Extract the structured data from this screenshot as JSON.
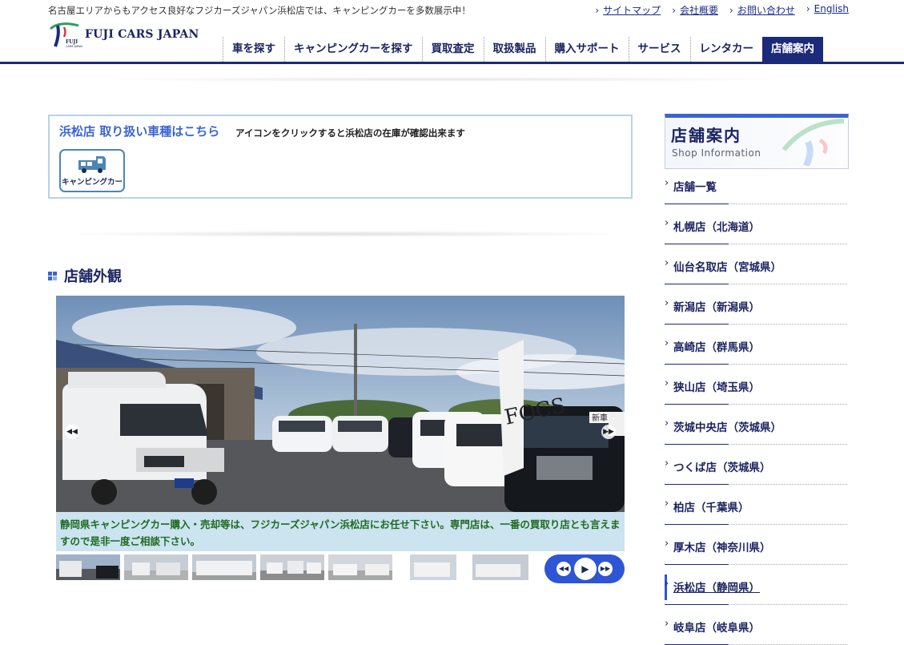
{
  "header": {
    "tagline": "名古屋エリアからもアクセス良好なフジカーズジャパン浜松店では、キャンピングカーを多数展示中！",
    "toplinks": [
      "サイトマップ",
      "会社概要",
      "お問い合わせ",
      "English"
    ],
    "logo_text": "FUJI CARS JAPAN",
    "logo_small": "FUJI",
    "logo_sub": "CARS JAPAN",
    "nav": [
      "車を探す",
      "キャンピングカーを探す",
      "買取査定",
      "取扱製品",
      "購入サポート",
      "サービス",
      "レンタカー",
      "店舗案内"
    ],
    "active_nav": "店舗案内"
  },
  "infobox": {
    "heading": "浜松店 取り扱い車種はこちら",
    "note": "アイコンをクリックすると浜松店の在庫が確認出来ます",
    "icon_label": "キャンピングカー",
    "icon": "camper-icon"
  },
  "section": {
    "title": "店舗外観"
  },
  "slideshow": {
    "caption": "静岡県キャンピングカー購入・売却等は、フジカーズジャパン浜松店にお任せ下さい。専門店は、一番の買取り店とも言えますので是非一度ご相談下さい。",
    "sign_text": "FOCS",
    "banner_text": "新車",
    "prev_icon": "chevrons-left-icon",
    "next_icon": "chevrons-right-icon",
    "play_icon": "play-icon"
  },
  "sidebar": {
    "title_jp": "店舗案内",
    "title_en": "Shop Information",
    "items": [
      "店舗一覧",
      "札幌店（北海道）",
      "仙台名取店（宮城県）",
      "新潟店（新潟県）",
      "高崎店（群馬県）",
      "狭山店（埼玉県）",
      "茨城中央店（茨城県）",
      "つくば店（茨城県）",
      "柏店（千葉県）",
      "厚木店（神奈川県）",
      "浜松店（静岡県）",
      "岐阜店（岐阜県）"
    ],
    "active_item": "浜松店（静岡県）"
  },
  "colors": {
    "navy": "#1c2a7a",
    "accent_blue": "#3b63d4",
    "caption_bg": "#cce3f0",
    "caption_text": "#1f6b22"
  }
}
